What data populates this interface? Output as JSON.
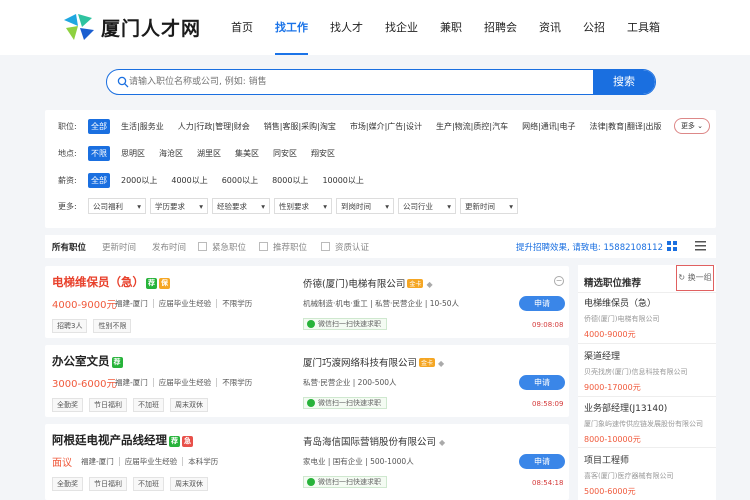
{
  "brand": {
    "name": "厦门人才网"
  },
  "nav": {
    "items": [
      "首页",
      "找工作",
      "找人才",
      "找企业",
      "兼职",
      "招聘会",
      "资讯",
      "公招",
      "工具箱"
    ],
    "active": "找工作"
  },
  "search": {
    "placeholder": "请输入职位名称或公司, 例如: 销售",
    "button": "搜索"
  },
  "filters": {
    "job": {
      "label": "职位:",
      "options": [
        "全部",
        "生活|服务业",
        "人力|行政|管理|财会",
        "销售|客服|采购|淘宝",
        "市场|媒介|广告|设计",
        "生产|物流|质控|汽车",
        "网络|通讯|电子",
        "法律|教育|翻译|出版"
      ],
      "more": "更多"
    },
    "area": {
      "label": "地点:",
      "options": [
        "不限",
        "思明区",
        "海沧区",
        "湖里区",
        "集美区",
        "同安区",
        "翔安区"
      ]
    },
    "salary": {
      "label": "薪资:",
      "options": [
        "全部",
        "2000以上",
        "4000以上",
        "6000以上",
        "8000以上",
        "10000以上"
      ]
    },
    "more": {
      "label": "更多:",
      "dropdowns": [
        "公司福利",
        "学历要求",
        "经验要求",
        "性别要求",
        "到岗时间",
        "公司行业",
        "更新时间"
      ]
    }
  },
  "toolbar": {
    "tabs": [
      "所有职位",
      "更新时间",
      "发布时间"
    ],
    "checks": [
      "紧急职位",
      "推荐职位",
      "资质认证"
    ],
    "promo": "提升招聘效果, 请致电:",
    "phone": "15882108112"
  },
  "jobs": [
    {
      "title": "电梯维保员（急）",
      "badges": [
        "荐",
        "保"
      ],
      "salary": "4000-9000元",
      "req": [
        "福建-厦门",
        "应届毕业生经验",
        "不限学历"
      ],
      "tags": [
        "招聘3人",
        "性别不限"
      ],
      "company": "侨德(厦门)电梯有限公司",
      "crown": "金卡",
      "company_info": "机械制造·机电·重工 | 私营·民营企业 | 10-50人",
      "wechat": "微信扫一扫快速求职",
      "apply": "申请",
      "time": "09:08:08"
    },
    {
      "title": "办公室文员",
      "badges": [
        "荐"
      ],
      "salary": "3000-6000元",
      "req": [
        "福建-厦门",
        "应届毕业生经验",
        "不限学历"
      ],
      "tags": [
        "全勤奖",
        "节日福利",
        "不加班",
        "周末双休"
      ],
      "company": "厦门巧渡网络科技有限公司",
      "crown": "金卡",
      "company_info": "私营·民营企业 | 200-500人",
      "wechat": "微信扫一扫快速求职",
      "apply": "申请",
      "time": "08:58:09"
    },
    {
      "title": "阿根廷电视产品线经理",
      "badges": [
        "荐",
        "急"
      ],
      "salary": "面议",
      "req": [
        "福建-厦门",
        "应届毕业生经验",
        "本科学历"
      ],
      "tags": [
        "全勤奖",
        "节日福利",
        "不加班",
        "周末双休"
      ],
      "company": "青岛海信国际营销股份有限公司",
      "crown": "",
      "company_info": "家电业 | 国有企业 | 500-1000人",
      "wechat": "微信扫一扫快速求职",
      "apply": "申请",
      "time": "08:54:18"
    }
  ],
  "sidebar": {
    "title": "精选职位推荐",
    "refresh": "换一组",
    "items": [
      {
        "name": "电梯维保员（急）",
        "company": "侨德(厦门)电梯有限公司",
        "salary": "4000-9000元"
      },
      {
        "name": "渠道经理",
        "company": "贝壳找房(厦门)信息科技有限公司",
        "salary": "9000-17000元"
      },
      {
        "name": "业务部经理(J13140)",
        "company": "厦门象屿速传供应链发展股份有限公司",
        "salary": "8000-10000元"
      },
      {
        "name": "项目工程师",
        "company": "喜客(厦门)医疗器械有限公司",
        "salary": "5000-6000元"
      }
    ]
  },
  "colors": {
    "accent": "#1a6fe0",
    "salary": "#f05a3c",
    "badge_green": "#27b33a",
    "badge_orange": "#f5a623",
    "badge_red": "#e8504a"
  }
}
